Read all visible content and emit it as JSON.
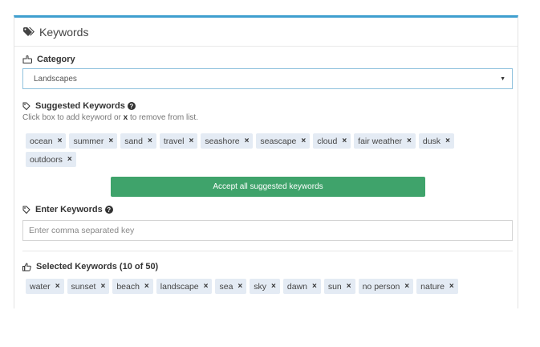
{
  "panel": {
    "title": "Keywords",
    "icon": "tags-icon"
  },
  "category": {
    "label": "Category",
    "selected": "Landscapes"
  },
  "suggested": {
    "label": "Suggested Keywords",
    "hint_prefix": "Click box to add keyword or ",
    "hint_x": "x",
    "hint_suffix": " to remove from list.",
    "keywords": [
      "ocean",
      "summer",
      "sand",
      "travel",
      "seashore",
      "seascape",
      "cloud",
      "fair weather",
      "dusk",
      "outdoors"
    ],
    "accept_label": "Accept all suggested keywords"
  },
  "enter": {
    "label": "Enter Keywords",
    "placeholder": "Enter comma separated key"
  },
  "selected": {
    "label": "Selected Keywords (10 of 50)",
    "keywords": [
      "water",
      "sunset",
      "beach",
      "landscape",
      "sea",
      "sky",
      "dawn",
      "sun",
      "no person",
      "nature"
    ]
  },
  "colors": {
    "accent": "#3f9fcf",
    "accept_button": "#3fa36b",
    "chip_bg": "#e4ebf4"
  }
}
